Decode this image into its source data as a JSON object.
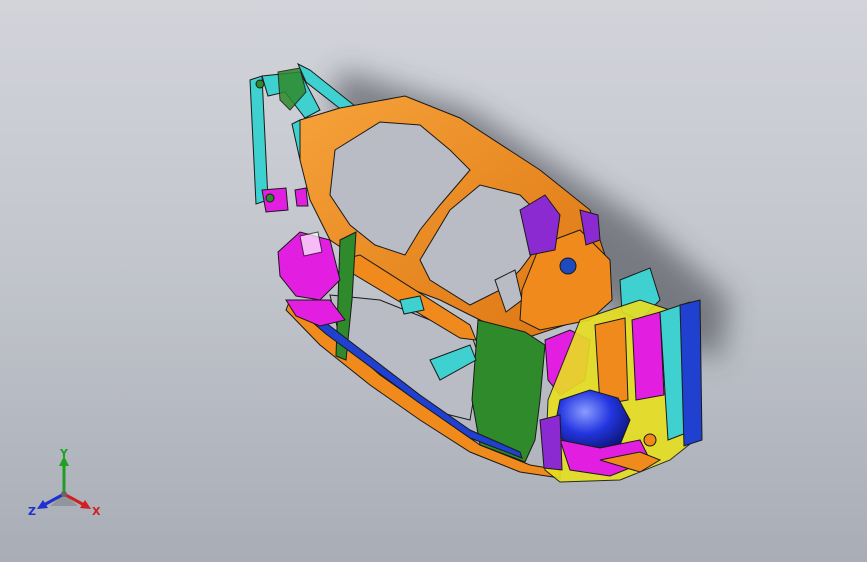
{
  "viewport": {
    "background_top": "#d2d4da",
    "background_bottom": "#a9adb6"
  },
  "model": {
    "colors": {
      "orange": "#f08a1c",
      "green": "#2e8a2a",
      "magenta": "#e21ee0",
      "cyan": "#3fd0d0",
      "blue": "#2030d0",
      "purple": "#8a2ad0",
      "yellow": "#e8e020",
      "edge": "#1a1a1a"
    }
  },
  "triad": {
    "x_label": "X",
    "y_label": "Y",
    "z_label": "Z",
    "x_color": "#d02020",
    "y_color": "#20a020",
    "z_color": "#2030d0"
  }
}
